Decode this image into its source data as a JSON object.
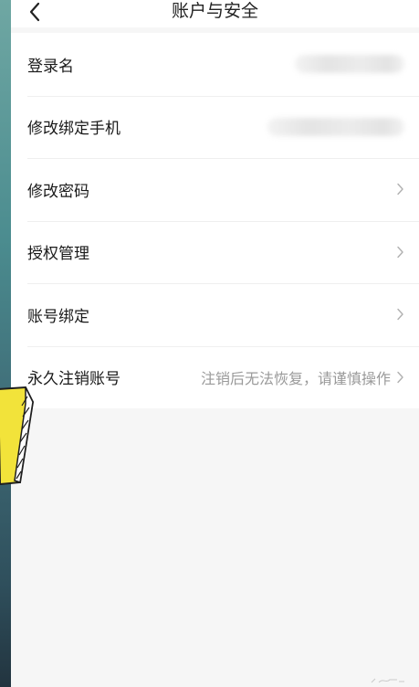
{
  "header": {
    "back_icon": "chevron-left-icon",
    "title": "账户与安全"
  },
  "rows": [
    {
      "label": "登录名",
      "value": "",
      "masked": true,
      "chevron": false
    },
    {
      "label": "修改绑定手机",
      "value": "",
      "masked": true,
      "chevron": false
    },
    {
      "label": "修改密码",
      "value": "",
      "masked": false,
      "chevron": true
    },
    {
      "label": "授权管理",
      "value": "",
      "masked": false,
      "chevron": true
    },
    {
      "label": "账号绑定",
      "value": "",
      "masked": false,
      "chevron": true
    },
    {
      "label": "永久注销账号",
      "value": "注销后无法恢复，请谨慎操作",
      "masked": false,
      "chevron": true
    }
  ],
  "colors": {
    "background": "#f6f6f6",
    "row_background": "#ffffff",
    "text_primary": "#1a1a1a",
    "text_secondary": "#9a9a9a",
    "sticker_yellow": "#f2e33a"
  }
}
